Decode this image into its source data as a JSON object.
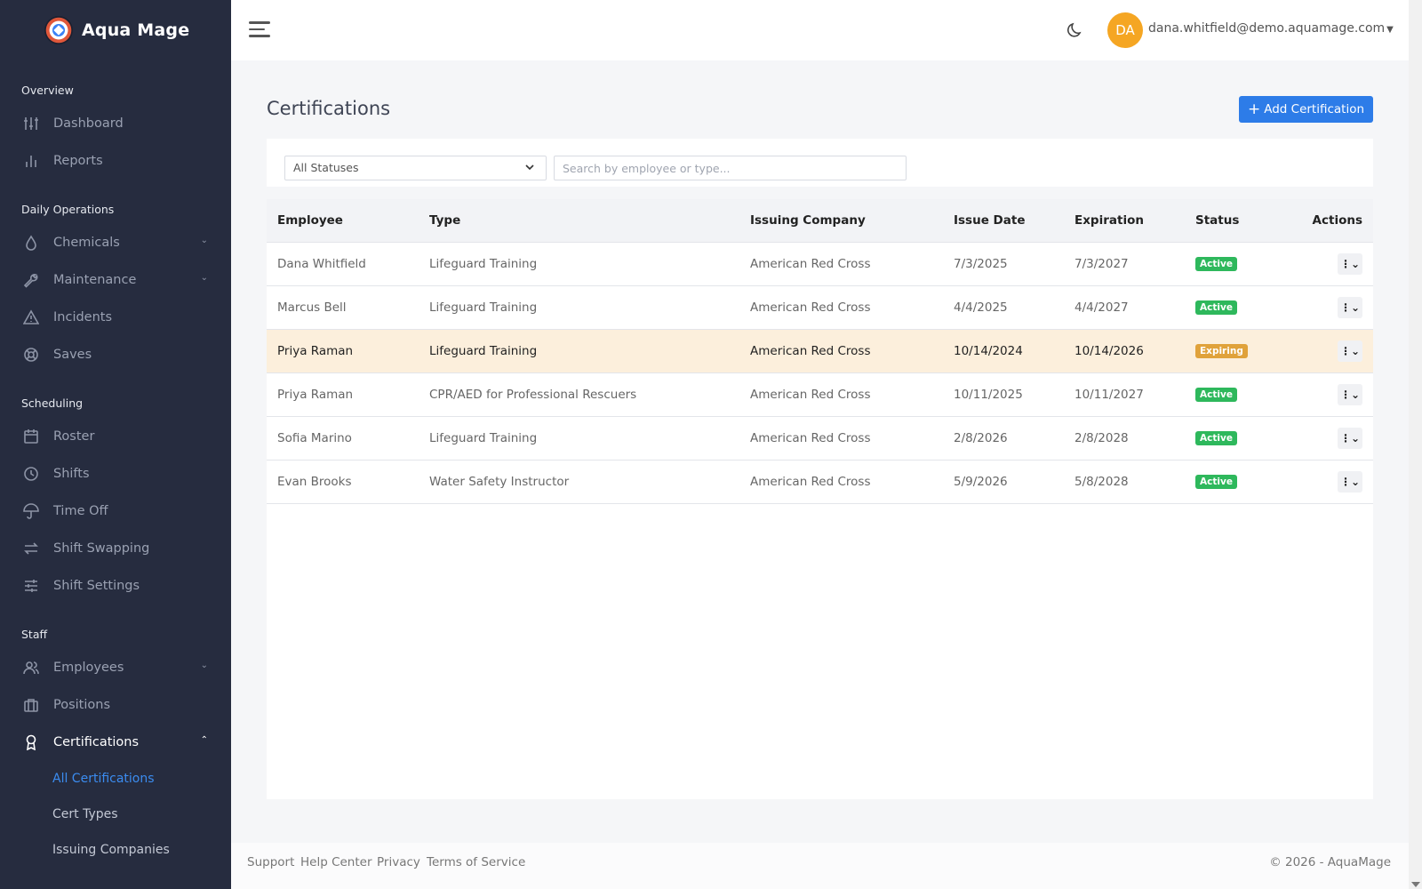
{
  "brand": {
    "name": "Aqua Mage"
  },
  "sidebar": {
    "sections": {
      "overview": "Overview",
      "daily": "Daily Operations",
      "scheduling": "Scheduling",
      "staff": "Staff"
    },
    "items": {
      "dashboard": "Dashboard",
      "reports": "Reports",
      "chemicals": "Chemicals",
      "maintenance": "Maintenance",
      "incidents": "Incidents",
      "saves": "Saves",
      "roster": "Roster",
      "shifts": "Shifts",
      "time_off": "Time Off",
      "shift_swapping": "Shift Swapping",
      "shift_settings": "Shift Settings",
      "employees": "Employees",
      "positions": "Positions",
      "certifications": "Certifications"
    },
    "sub_items": {
      "all_certifications": "All Certifications",
      "cert_types": "Cert Types",
      "issuing_companies": "Issuing Companies"
    }
  },
  "topbar": {
    "avatar_initials": "DA",
    "user_email": "dana.whitfield@demo.aquamage.com"
  },
  "page": {
    "title": "Certifications",
    "add_button": "Add Certification"
  },
  "filters": {
    "status_selected": "All Statuses",
    "search_placeholder": "Search by employee or type..."
  },
  "table": {
    "headers": [
      "Employee",
      "Type",
      "Issuing Company",
      "Issue Date",
      "Expiration",
      "Status",
      "Actions"
    ],
    "rows": [
      {
        "employee": "Dana Whitfield",
        "type": "Lifeguard Training",
        "company": "American Red Cross",
        "issue": "7/3/2025",
        "expiration": "7/3/2027",
        "status": "Active"
      },
      {
        "employee": "Marcus Bell",
        "type": "Lifeguard Training",
        "company": "American Red Cross",
        "issue": "4/4/2025",
        "expiration": "4/4/2027",
        "status": "Active"
      },
      {
        "employee": "Priya Raman",
        "type": "Lifeguard Training",
        "company": "American Red Cross",
        "issue": "10/14/2024",
        "expiration": "10/14/2026",
        "status": "Expiring"
      },
      {
        "employee": "Priya Raman",
        "type": "CPR/AED for Professional Rescuers",
        "company": "American Red Cross",
        "issue": "10/11/2025",
        "expiration": "10/11/2027",
        "status": "Active"
      },
      {
        "employee": "Sofia Marino",
        "type": "Lifeguard Training",
        "company": "American Red Cross",
        "issue": "2/8/2026",
        "expiration": "2/8/2028",
        "status": "Active"
      },
      {
        "employee": "Evan Brooks",
        "type": "Water Safety Instructor",
        "company": "American Red Cross",
        "issue": "5/9/2026",
        "expiration": "5/8/2028",
        "status": "Active"
      }
    ]
  },
  "footer": {
    "support": "Support",
    "help_center": "Help Center",
    "privacy": "Privacy",
    "terms": "Terms of Service",
    "copyright": "© 2026 - AquaMage"
  },
  "colors": {
    "sidebar_bg": "#262c3f",
    "accent": "#2d7ce8",
    "active_badge": "#2eb85c",
    "expiring_badge": "#e0a23b",
    "highlight_row": "#fcefdc",
    "avatar": "#f5a623"
  }
}
